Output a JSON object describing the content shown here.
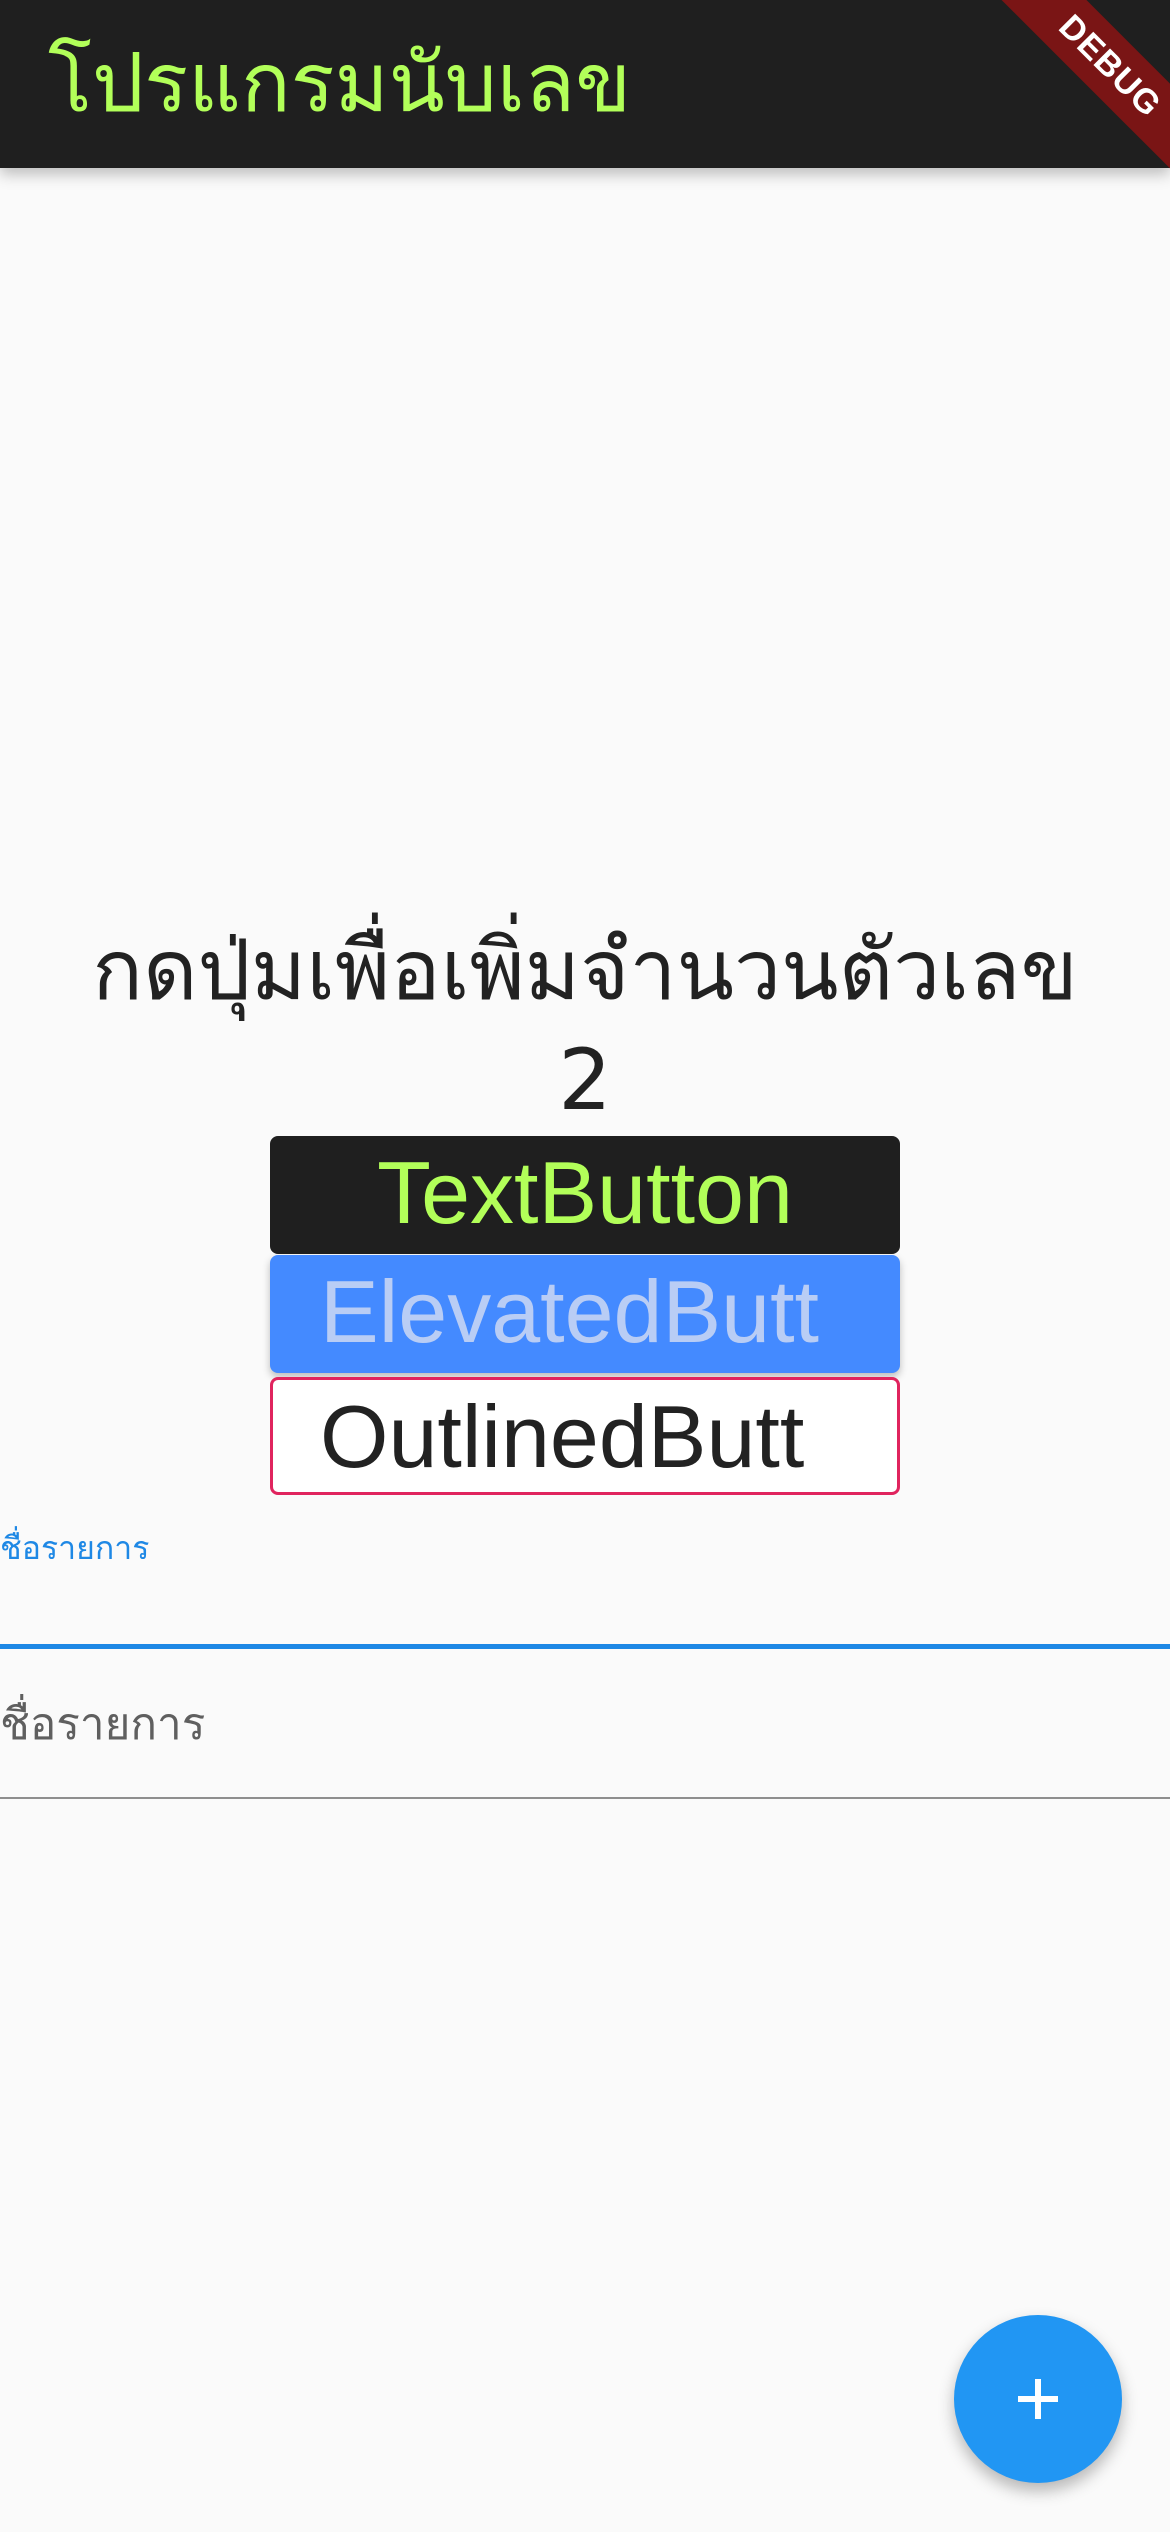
{
  "app_bar": {
    "title": "โปรแกรมนับเลข",
    "debug_label": "DEBUG"
  },
  "main": {
    "prompt": "กดปุ่มเพื่อเพิ่มจำนวนตัวเลข",
    "counter": "2",
    "text_button_label": "TextButton",
    "elevated_button_label": "ElevatedButt",
    "outlined_button_label": "OutlinedButt"
  },
  "form": {
    "field1_label": "ชื่อรายการ",
    "field2_placeholder": "ชื่อรายการ"
  },
  "fab": {
    "icon": "plus-icon"
  },
  "colors": {
    "app_bar_bg": "#1f1f1f",
    "title_color": "#b2ff59",
    "elevated_bg": "#448aff",
    "outline_color": "#e0245e",
    "focus_color": "#1e88e5",
    "fab_bg": "#2196f3"
  }
}
